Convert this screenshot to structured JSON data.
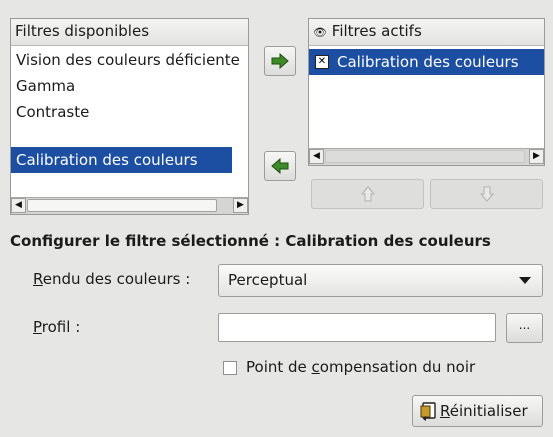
{
  "available": {
    "header": "Filtres disponibles",
    "items": [
      "Vision des couleurs déficiente",
      "Gamma",
      "Contraste",
      "Calibration des couleurs"
    ],
    "selected_index": 3
  },
  "active": {
    "header": "Filtres actifs",
    "header_icon": "eye-icon",
    "items": [
      {
        "label": "Calibration des couleurs",
        "enabled": true
      }
    ],
    "check_glyph": "✕"
  },
  "transfer": {
    "add_icon": "arrow-right-icon",
    "remove_icon": "arrow-left-icon",
    "up_icon": "arrow-up-icon",
    "down_icon": "arrow-down-icon"
  },
  "scroll": {
    "left_glyph": "◀",
    "right_glyph": "▶"
  },
  "configure": {
    "title": "Configurer le filtre sélectionné : Calibration des couleurs",
    "rendering": {
      "label_mnemonic": "R",
      "label_rest": "endu des couleurs :",
      "value": "Perceptual"
    },
    "profile": {
      "label_mnemonic": "P",
      "label_rest": "rofil :",
      "value": "",
      "browse_label": "..."
    },
    "black_point": {
      "label_before": "Point de ",
      "label_mnemonic": "c",
      "label_after": "ompensation du noir",
      "checked": false
    },
    "reset": {
      "label_mnemonic": "R",
      "label_rest": "éinitialiser",
      "icon": "reset-icon"
    }
  }
}
